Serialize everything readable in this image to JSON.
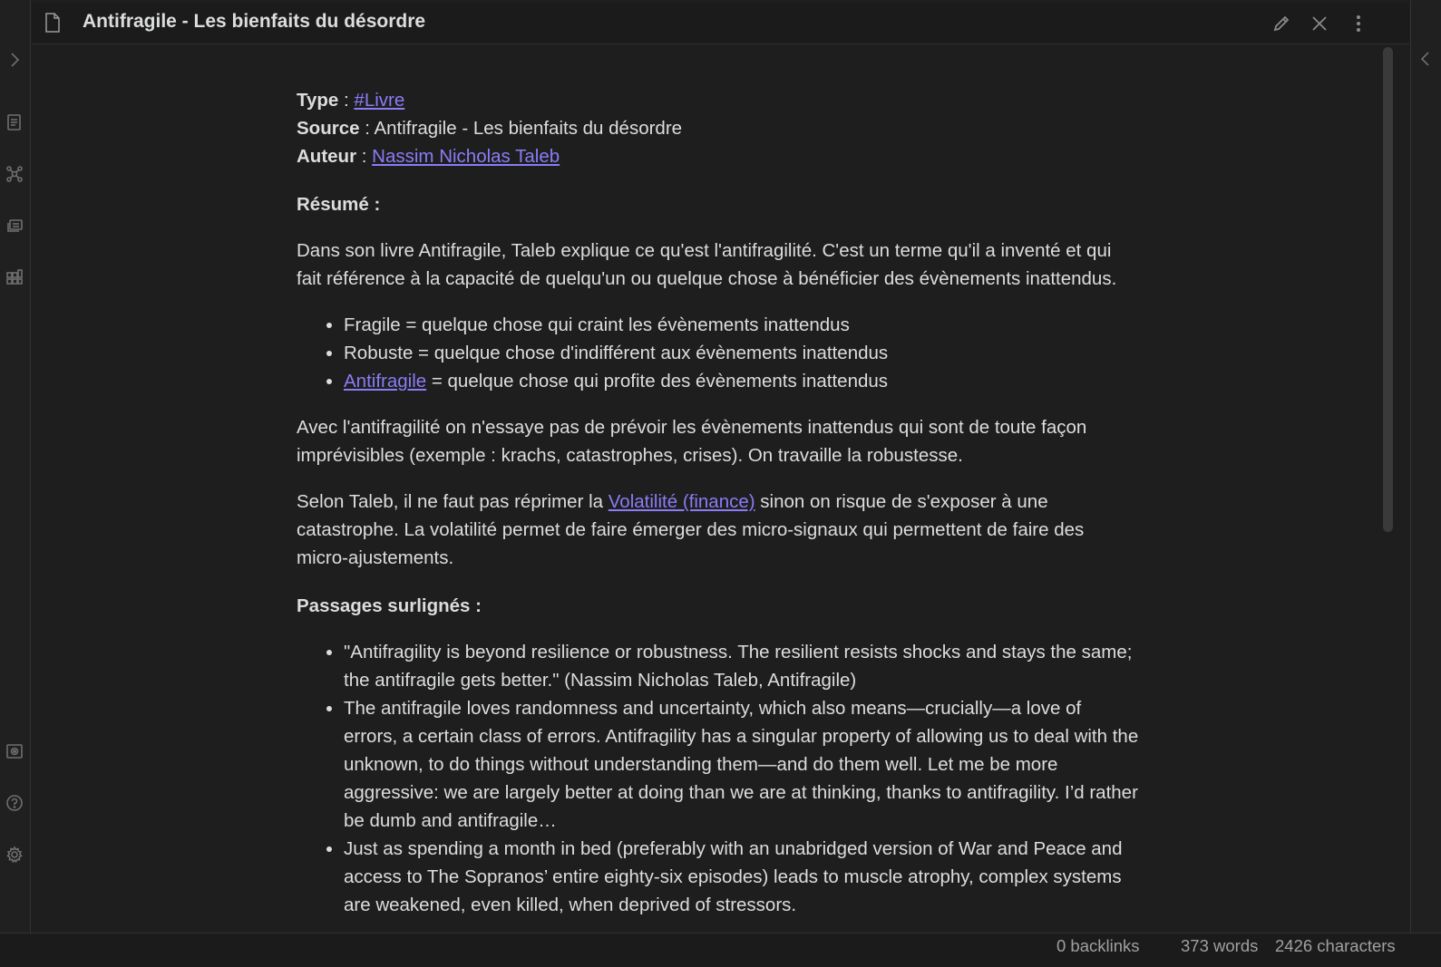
{
  "header": {
    "title": "Antifragile - Les bienfaits du désordre"
  },
  "ribbon": {
    "icons": [
      "expand-chevron-icon",
      "files-icon",
      "graph-view-icon",
      "slides-icon",
      "kanban-icon",
      "vault-icon",
      "help-icon",
      "settings-icon"
    ]
  },
  "note": {
    "meta": {
      "type_label": "Type",
      "type_sep": " : ",
      "type_value": "#Livre",
      "source_label": "Source",
      "source_sep": " : ",
      "source_value": "Antifragile - Les bienfaits du désordre",
      "author_label": "Auteur",
      "author_sep": " : ",
      "author_value": "Nassim Nicholas Taleb"
    },
    "resume_heading": "Résumé :",
    "intro": "Dans son livre Antifragile, Taleb explique ce qu'est l'antifragilité. C'est un terme qu'il a inventé et qui fait référence à la capacité de quelqu'un ou quelque chose à bénéficier des évènements inattendus.",
    "definitions": {
      "fragile": "Fragile = quelque chose qui craint les évènements inattendus",
      "robuste": "Robuste = quelque chose d'indifférent aux évènements inattendus",
      "antifragile_link": "Antifragile",
      "antifragile_rest": " = quelque chose qui profite des évènements inattendus"
    },
    "paragraph2": "Avec l'antifragilité on n'essaye pas de prévoir les évènements inattendus qui sont de toute façon imprévisibles (exemple : krachs, catastrophes, crises). On travaille la robustesse.",
    "paragraph3_before": "Selon Taleb, il ne faut pas réprimer la ",
    "paragraph3_link": "Volatilité (finance)",
    "paragraph3_after": " sinon on risque de s'exposer à une catastrophe. La volatilité permet de faire émerger des micro-signaux qui permettent de faire des micro-ajustements.",
    "highlights_heading": "Passages surlignés :",
    "highlights": [
      "\"Antifragility is beyond resilience or robustness. The resilient resists shocks and stays the same; the antifragile gets better.\" (Nassim Nicholas Taleb, Antifragile)",
      "The antifragile loves randomness and uncertainty, which also means—crucially—a love of errors, a certain class of errors. Antifragility has a singular property of allowing us to deal with the unknown, to do things without understanding them—and do them well. Let me be more aggressive: we are largely better at doing than we are at thinking, thanks to antifragility. I’d rather be dumb and antifragile…",
      "Just as spending a month in bed (preferably with an unabridged version of War and Peace and access to The Sopranos’ entire eighty-six episodes) leads to muscle atrophy, complex systems are weakened, even killed, when deprived of stressors."
    ]
  },
  "status": {
    "backlinks": "0 backlinks",
    "words": "373 words",
    "characters": "2426 characters"
  },
  "colors": {
    "background": "#1e1e1e",
    "text": "#dcddde",
    "link": "#8a7cf5"
  }
}
